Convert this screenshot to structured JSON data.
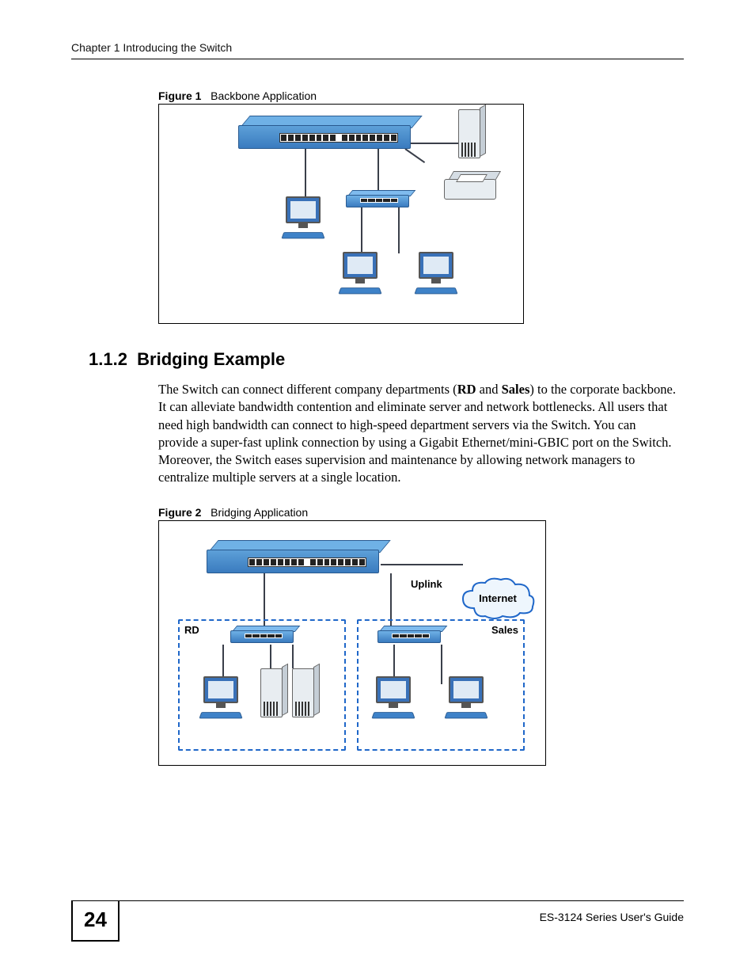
{
  "header": {
    "chapter_title": "Chapter 1 Introducing the Switch"
  },
  "figure1": {
    "label": "Figure 1",
    "caption": "Backbone Application"
  },
  "section": {
    "number": "1.1.2",
    "title": "Bridging Example",
    "body_part1": "The Switch can connect different company departments (",
    "bold_rd": "RD",
    "body_and": " and ",
    "bold_sales": "Sales",
    "body_part2": ") to the corporate backbone. It can alleviate bandwidth contention and eliminate server and network bottlenecks. All users that need high bandwidth can connect to high-speed department servers via the Switch. You can provide a super-fast uplink connection by using a Gigabit Ethernet/mini-GBIC port on the Switch. Moreover, the Switch eases supervision and maintenance by allowing network managers to centralize multiple servers at a single location."
  },
  "figure2": {
    "label": "Figure 2",
    "caption": "Bridging Application",
    "uplink_label": "Uplink",
    "internet_label": "Internet",
    "rd_label": "RD",
    "sales_label": "Sales"
  },
  "footer": {
    "page_number": "24",
    "guide_title": "ES-3124 Series User's Guide"
  }
}
